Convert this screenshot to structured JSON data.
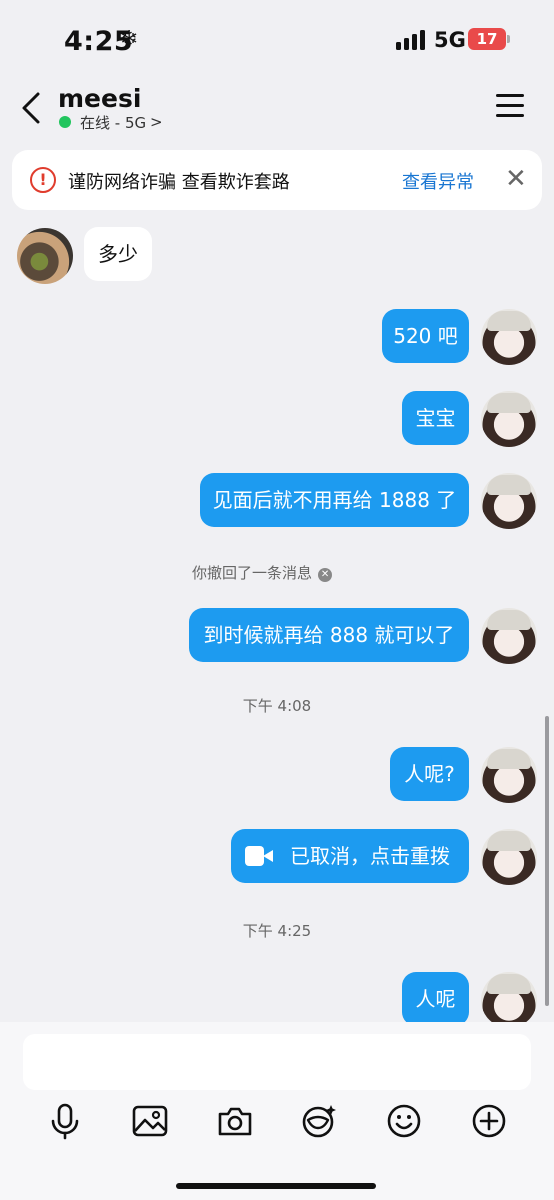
{
  "status_bar": {
    "time": "4:25",
    "network": "5G",
    "battery": "17"
  },
  "header": {
    "name": "meesi",
    "status": "在线 - 5G",
    "status_chevron": ">"
  },
  "banner": {
    "text": "谨防网络诈骗  查看欺诈套路",
    "link": "查看异常"
  },
  "messages": {
    "in_1": "多少",
    "out_1": "520 吧",
    "out_2": "宝宝",
    "out_3": "见面后就不用再给 1888 了",
    "recalled": "你撤回了一条消息",
    "out_4": "到时候就再给 888 就可以了",
    "time_1": "下午 4:08",
    "out_5": "人呢?",
    "video_call": "已取消，点击重拨",
    "time_2": "下午 4:25",
    "out_6": "人呢"
  },
  "toolbar": {
    "icons": [
      "microphone-icon",
      "image-icon",
      "camera-icon",
      "sticker-icon",
      "emoji-icon",
      "plus-icon"
    ]
  },
  "colors": {
    "bubble_out": "#1d9bf0",
    "link": "#1976d2",
    "warning": "#e03c2d",
    "online": "#22c55e"
  }
}
